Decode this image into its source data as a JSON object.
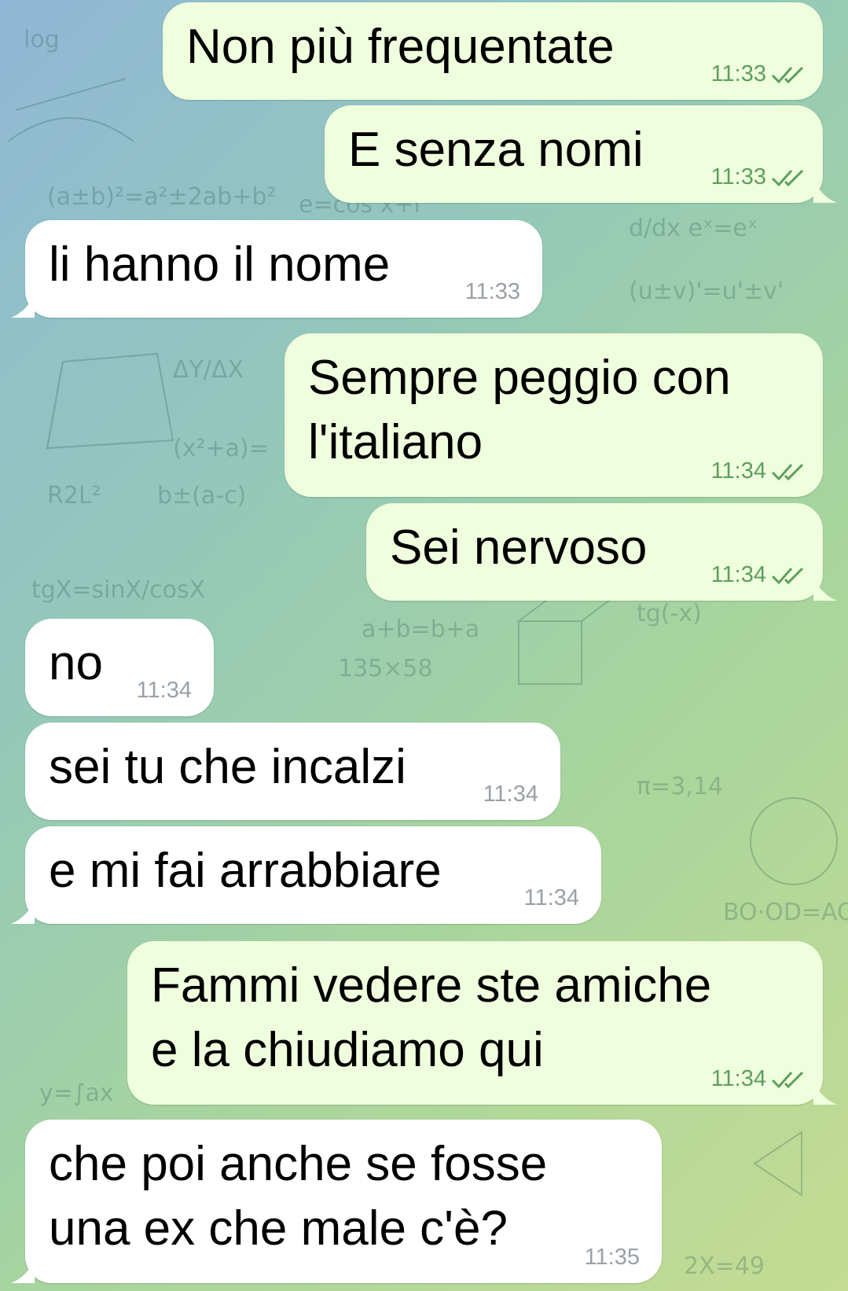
{
  "messages": [
    {
      "id": "m1",
      "direction": "out",
      "text": "Non più frequentate",
      "time": "11:33",
      "read": true
    },
    {
      "id": "m2",
      "direction": "out",
      "text": "E senza nomi",
      "time": "11:33",
      "read": true
    },
    {
      "id": "m3",
      "direction": "in",
      "text": "li hanno il nome",
      "time": "11:33"
    },
    {
      "id": "m4",
      "direction": "out",
      "text": "Sempre peggio con\nl'italiano",
      "time": "11:34",
      "read": true
    },
    {
      "id": "m5",
      "direction": "out",
      "text": "Sei nervoso",
      "time": "11:34",
      "read": true
    },
    {
      "id": "m6",
      "direction": "in",
      "text": "no",
      "time": "11:34"
    },
    {
      "id": "m7",
      "direction": "in",
      "text": "sei tu che incalzi",
      "time": "11:34"
    },
    {
      "id": "m8",
      "direction": "in",
      "text": "e mi fai arrabbiare",
      "time": "11:34"
    },
    {
      "id": "m9",
      "direction": "out",
      "text": "Fammi vedere ste amiche\ne la chiudiamo qui",
      "time": "11:34",
      "read": true
    },
    {
      "id": "m10",
      "direction": "in",
      "text": "che poi anche se fosse\nuna ex che male c'è?",
      "time": "11:35"
    }
  ],
  "colors": {
    "outgoing_bubble": "#effedd",
    "incoming_bubble": "#ffffff",
    "read_check": "#5e9e5e",
    "incoming_time": "#9aa0a6"
  },
  "icons": {
    "read_receipt": "double-check-icon"
  }
}
